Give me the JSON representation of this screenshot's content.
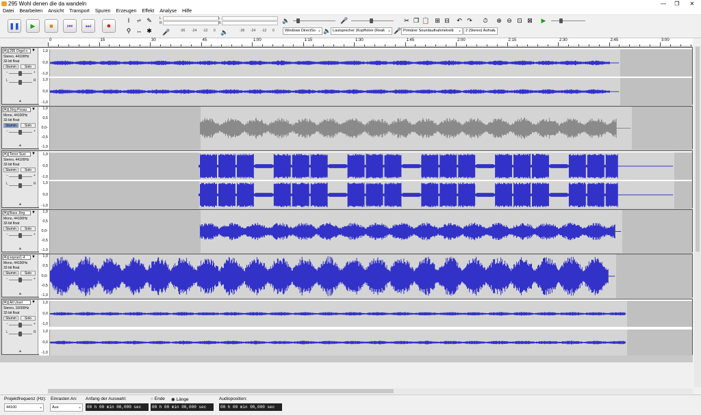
{
  "window": {
    "title": "295 Wohl denen die da wandeln",
    "minimize": "—",
    "maximize": "❐",
    "close": "✕"
  },
  "menu": [
    "Datei",
    "Bearbeiten",
    "Ansicht",
    "Transport",
    "Spuren",
    "Erzeugen",
    "Effekt",
    "Analyse",
    "Hilfe"
  ],
  "meters": {
    "rec_ticks": [
      "-36",
      "-24",
      "-12",
      "0"
    ],
    "play_ticks": [
      "-36",
      "-24",
      "-12",
      "0"
    ],
    "lr_rec": [
      "L",
      "R"
    ],
    "lr_play": [
      "L",
      "R"
    ]
  },
  "devices": {
    "host": "Windows DirectSo",
    "output": "Lautsprecher (Kopfhörer (Realt",
    "input": "Primärer Soundaufnahmetreib",
    "channels": "2 (Stereo) Aufnah"
  },
  "ruler": {
    "labels": [
      "0",
      "15",
      "30",
      "45",
      "1:00",
      "1:15",
      "1:30",
      "1:45",
      "2:00",
      "2:15",
      "2:30",
      "2:45",
      "3:00"
    ]
  },
  "scale_labels": [
    "1,0",
    "0,0",
    "-1,0"
  ],
  "scale_labels_mono": [
    "1,0",
    "0,5",
    "0,0-",
    "-0,5",
    "-1,0"
  ],
  "tracks": [
    {
      "name": "295 Orgel o",
      "info": [
        "Stereo, 44100Hz",
        "32-bit float"
      ],
      "mute": "Stumm",
      "solo": "Solo",
      "mute_on": false
    },
    {
      "name": "Jörg Posau",
      "info": [
        "Mono, 44100Hz",
        "32-bit float"
      ],
      "mute": "Stumm",
      "solo": "Solo",
      "mute_on": true
    },
    {
      "name": "Tenor Susi",
      "info": [
        "Stereo, 44100Hz",
        "32-bit float"
      ],
      "mute": "Stumm",
      "solo": "Solo",
      "mute_on": false
    },
    {
      "name": "Bass Jörg",
      "info": [
        "Mono, 44100Hz",
        "32-bit float"
      ],
      "mute": "Stumm",
      "solo": "Solo",
      "mute_on": false
    },
    {
      "name": "sopran1-4",
      "info": [
        "Mono, 44100Hz",
        "32-bit float"
      ],
      "mute": "Stumm",
      "solo": "Solo",
      "mute_on": false
    },
    {
      "name": "Alt Ursel",
      "info": [
        "Stereo, 16000Hz",
        "32-bit float"
      ],
      "mute": "Stumm",
      "solo": "Solo",
      "mute_on": false
    }
  ],
  "gain_lr": [
    "L",
    "R"
  ],
  "selection": {
    "rate_label": "Projektfrequenz (Hz):",
    "rate_value": "44100",
    "snap_label": "Einrasten An:",
    "snap_value": "Aus",
    "sel_label": "Anfang der Auswahl:",
    "end_label": "Ende",
    "length_label": "Länge",
    "pos_label": "Audioposition:",
    "start_time": "00 h 00 min 00,000 sec",
    "end_time": "00 h 00 min 00,000 sec",
    "pos_time": "00 h 00 min 00,000 sec"
  },
  "colors": {
    "wave": "#3232c8",
    "wave_muted": "#8a8a8a",
    "clip": "#d4d4d4",
    "bg": "#c0c0c0"
  }
}
